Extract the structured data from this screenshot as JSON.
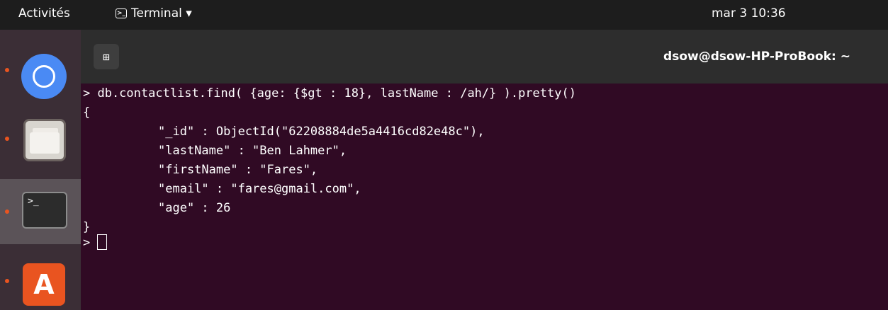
{
  "topbar": {
    "activities": "Activités",
    "app_name": "Terminal ▾",
    "app_icon_glyph": ">_",
    "clock": "mar 3  10:36"
  },
  "dock": {
    "items": [
      {
        "name": "chrome",
        "running": true
      },
      {
        "name": "files",
        "running": true
      },
      {
        "name": "terminal",
        "running": true,
        "active": true,
        "glyph": ">_"
      },
      {
        "name": "software",
        "running": true,
        "glyph": "A"
      }
    ]
  },
  "window": {
    "title": "dsow@dsow-HP-ProBook: ~",
    "new_tab_glyph": "⊞"
  },
  "terminal": {
    "command": "> db.contactlist.find( {age: {$gt : 18}, lastName : /ah/} ).pretty()",
    "open_brace": "{",
    "fields": [
      "\"_id\" : ObjectId(\"62208884de5a4416cd82e48c\"),",
      "\"lastName\" : \"Ben Lahmer\",",
      "\"firstName\" : \"Fares\",",
      "\"email\" : \"fares@gmail.com\",",
      "\"age\" : 26"
    ],
    "close_brace": "}",
    "prompt": "> "
  },
  "colors": {
    "terminal_bg": "#300a24",
    "topbar_bg": "#1d1d1d",
    "accent": "#e95420"
  }
}
